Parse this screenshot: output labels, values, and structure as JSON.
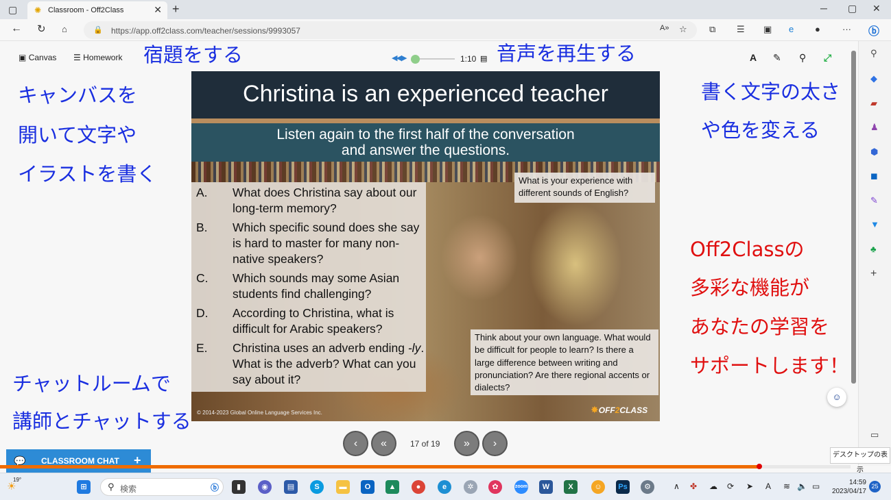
{
  "browser": {
    "tab_title": "Classroom - Off2Class",
    "url": "https://app.off2class.com/teacher/sessions/9993057"
  },
  "toolbar": {
    "canvas_label": "Canvas",
    "homework_label": "Homework",
    "audio_time": "1:10"
  },
  "annotations": {
    "homework": "宿題をする",
    "audio": "音声を再生する",
    "canvas_line1": "キャンバスを",
    "canvas_line2": "開いて文字や",
    "canvas_line3": "イラストを書く",
    "pen_line1": "書く文字の太さ",
    "pen_line2": "や色を変える",
    "feature_line1": "Off2Classの",
    "feature_line2": "多彩な機能が",
    "feature_line3": "あなたの学習を",
    "feature_line4": "サポートします！",
    "chat_line1": "チャットルームで",
    "chat_line2": "講師とチャットする"
  },
  "slide": {
    "title": "Christina is an experienced teacher",
    "subtitle_line1": "Listen again to the first half of the conversation",
    "subtitle_line2": "and answer the questions.",
    "questions": [
      {
        "letter": "A.",
        "text": "What does Christina say about our long-term memory?"
      },
      {
        "letter": "B.",
        "text": "Which specific sound does she say is hard to master for many non-native speakers?"
      },
      {
        "letter": "C.",
        "text": "Which sounds may some Asian students find challenging?"
      },
      {
        "letter": "D.",
        "text": "According to Christina, what is difficult for Arabic speakers?"
      },
      {
        "letter": "E.",
        "text_before": "Christina uses an adverb ending ",
        "text_em": "-ly",
        "text_after": ". What is the adverb? What can you say about it?"
      }
    ],
    "box1": "What is your experience with different sounds of English?",
    "box2": "Think about your own language. What would be difficult for people to learn? Is there a large difference between writing and pronunciation? Are there regional accents or dialects?",
    "copyright": "© 2014-2023 Global Online Language Services Inc.",
    "logo_text_pre": "OFF",
    "logo_text_post": "CLASS"
  },
  "navigation": {
    "page_indicator": "17 of 19"
  },
  "chat": {
    "label": "CLASSROOM CHAT"
  },
  "side_tooltip": "デスクトップの表示",
  "taskbar": {
    "temperature": "19°",
    "search_placeholder": "検索",
    "time": "14:59",
    "date": "2023/04/17",
    "notifications": "25"
  },
  "colors": {
    "annotation_blue": "#1a2fe0",
    "annotation_red": "#e01010",
    "chat_button": "#2d8bd6",
    "progress": "#ef6c00",
    "slide_header": "#1f2d3a",
    "slide_subheader": "#2b5361"
  }
}
